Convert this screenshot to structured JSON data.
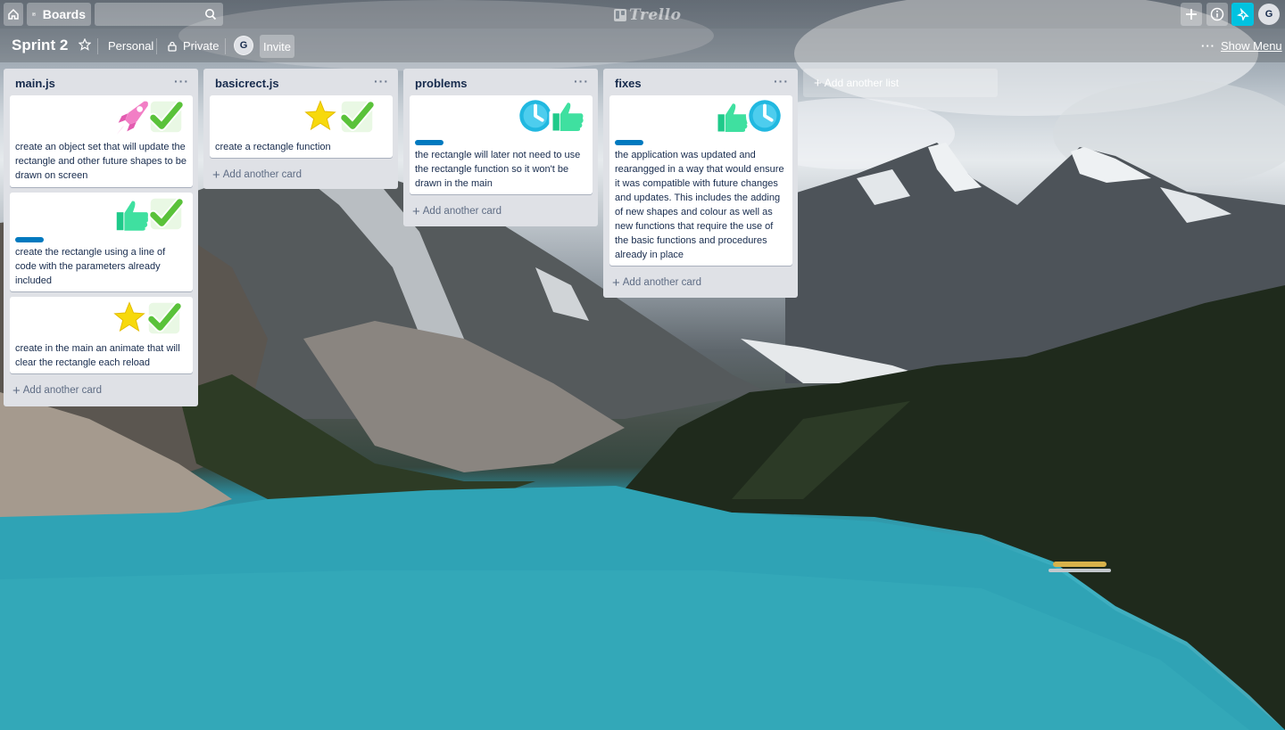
{
  "header": {
    "boards_label": "Boards",
    "search_value": "",
    "logo_text": "Trello",
    "user_initial": "G",
    "notification_accent": "#00c2e0"
  },
  "board": {
    "title": "Sprint 2",
    "team_label": "Personal",
    "visibility_label": "Private",
    "member_initial": "G",
    "invite_label": "Invite",
    "show_menu_label": "Show Menu"
  },
  "lists": [
    {
      "title": "main.js",
      "add_card_label": "Add another card",
      "cards": [
        {
          "stickers": [
            "rocket",
            "check"
          ],
          "label_color": "",
          "text": "create an object set that will update the rectangle and other future shapes to be drawn on screen"
        },
        {
          "stickers": [
            "thumbsup",
            "check"
          ],
          "label_color": "#0079bf",
          "text": "create the rectangle using a line of code with the parameters already included"
        },
        {
          "stickers": [
            "star",
            "check"
          ],
          "label_color": "",
          "text": "create in the main an animate that will clear the rectangle each reload"
        }
      ]
    },
    {
      "title": "basicrect.js",
      "add_card_label": "Add another card",
      "cards": [
        {
          "stickers": [
            "star",
            "check"
          ],
          "label_color": "",
          "text": "create a rectangle function"
        }
      ]
    },
    {
      "title": "problems",
      "add_card_label": "Add another card",
      "cards": [
        {
          "stickers": [
            "clock",
            "thumbsup"
          ],
          "label_color": "#0079bf",
          "text": "the rectangle will later not need to use the rectangle function so it won't be drawn in the main"
        }
      ]
    },
    {
      "title": "fixes",
      "add_card_label": "Add another card",
      "cards": [
        {
          "stickers": [
            "thumbsup",
            "clock"
          ],
          "label_color": "#0079bf",
          "text": "the application was updated and rearangged in a way that would ensure it was compatible with future changes and updates. This includes the adding of new shapes and colour as well as new functions that require the use of the basic functions and procedures already in place"
        }
      ]
    }
  ],
  "add_list_label": "Add another list",
  "icons": [
    "home-icon",
    "boards-icon",
    "search-icon",
    "trello-logo-icon",
    "plus-icon",
    "info-icon",
    "notification-icon",
    "star-icon",
    "lock-icon",
    "more-icon"
  ]
}
